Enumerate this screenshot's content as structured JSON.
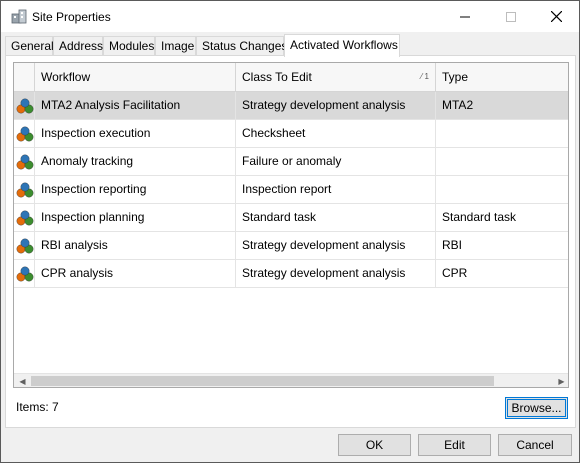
{
  "window": {
    "title": "Site Properties",
    "icon": "site-building-icon"
  },
  "tabs": [
    {
      "label": "General"
    },
    {
      "label": "Address"
    },
    {
      "label": "Modules"
    },
    {
      "label": "Image"
    },
    {
      "label": "Status Changes"
    },
    {
      "label": "Activated Workflows",
      "active": true
    }
  ],
  "grid": {
    "columns": {
      "workflow": "Workflow",
      "class_to_edit": "Class To Edit",
      "type": "Type",
      "sort_indicator": "1"
    },
    "rows": [
      {
        "workflow": "MTA2 Analysis Facilitation",
        "class_to_edit": "Strategy development analysis",
        "type": "MTA2",
        "selected": true
      },
      {
        "workflow": "Inspection execution",
        "class_to_edit": "Checksheet",
        "type": ""
      },
      {
        "workflow": "Anomaly tracking",
        "class_to_edit": "Failure or anomaly",
        "type": ""
      },
      {
        "workflow": "Inspection reporting",
        "class_to_edit": "Inspection report",
        "type": ""
      },
      {
        "workflow": "Inspection planning",
        "class_to_edit": "Standard task",
        "type": "Standard task"
      },
      {
        "workflow": "RBI analysis",
        "class_to_edit": "Strategy development analysis",
        "type": "RBI"
      },
      {
        "workflow": "CPR analysis",
        "class_to_edit": "Strategy development analysis",
        "type": "CPR"
      }
    ]
  },
  "footer": {
    "items_count": "Items: 7",
    "browse_label": "Browse..."
  },
  "buttons": {
    "ok": "OK",
    "edit": "Edit",
    "cancel": "Cancel"
  }
}
